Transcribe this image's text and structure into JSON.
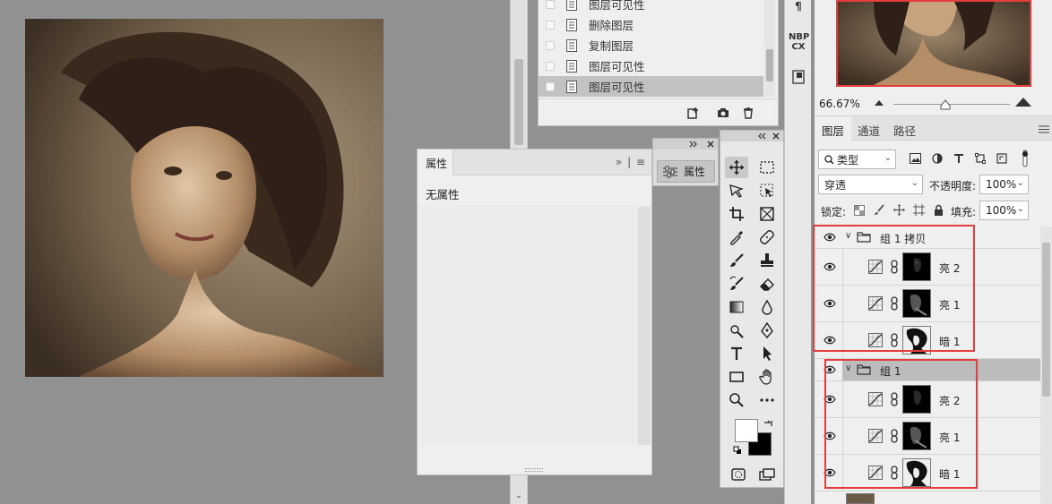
{
  "history": {
    "items": [
      {
        "label": "图层可见性"
      },
      {
        "label": "删除图层"
      },
      {
        "label": "复制图层"
      },
      {
        "label": "图层可见性"
      },
      {
        "label": "图层可见性"
      }
    ]
  },
  "properties": {
    "tab_label": "属性",
    "empty_label": "无属性",
    "mini_button_label": "属性",
    "collapse_glyph": "»",
    "menu_glyph": "≡"
  },
  "side_strip": {
    "nbp_label": "NBP",
    "cx_label": "CX"
  },
  "navigator": {
    "zoom": "66.67%"
  },
  "layers_panel": {
    "tabs": [
      "图层",
      "通道",
      "路径"
    ],
    "filter_kind": "类型",
    "blend_mode": "穿透",
    "opacity_label": "不透明度:",
    "opacity_value": "100%",
    "lock_label": "锁定:",
    "fill_label": "填充:",
    "fill_value": "100%",
    "groups": [
      {
        "name": "组 1 拷贝",
        "selected": false,
        "layers": [
          {
            "name": "亮 2"
          },
          {
            "name": "亮 1"
          },
          {
            "name": "暗 1"
          }
        ]
      },
      {
        "name": "组 1",
        "selected": true,
        "layers": [
          {
            "name": "亮 2"
          },
          {
            "name": "亮 1"
          },
          {
            "name": "暗 1"
          }
        ]
      }
    ]
  },
  "colors": {
    "highlight_box": "#e53c3c",
    "foreground_swatch": "#ffffff",
    "background_swatch": "#000000"
  }
}
